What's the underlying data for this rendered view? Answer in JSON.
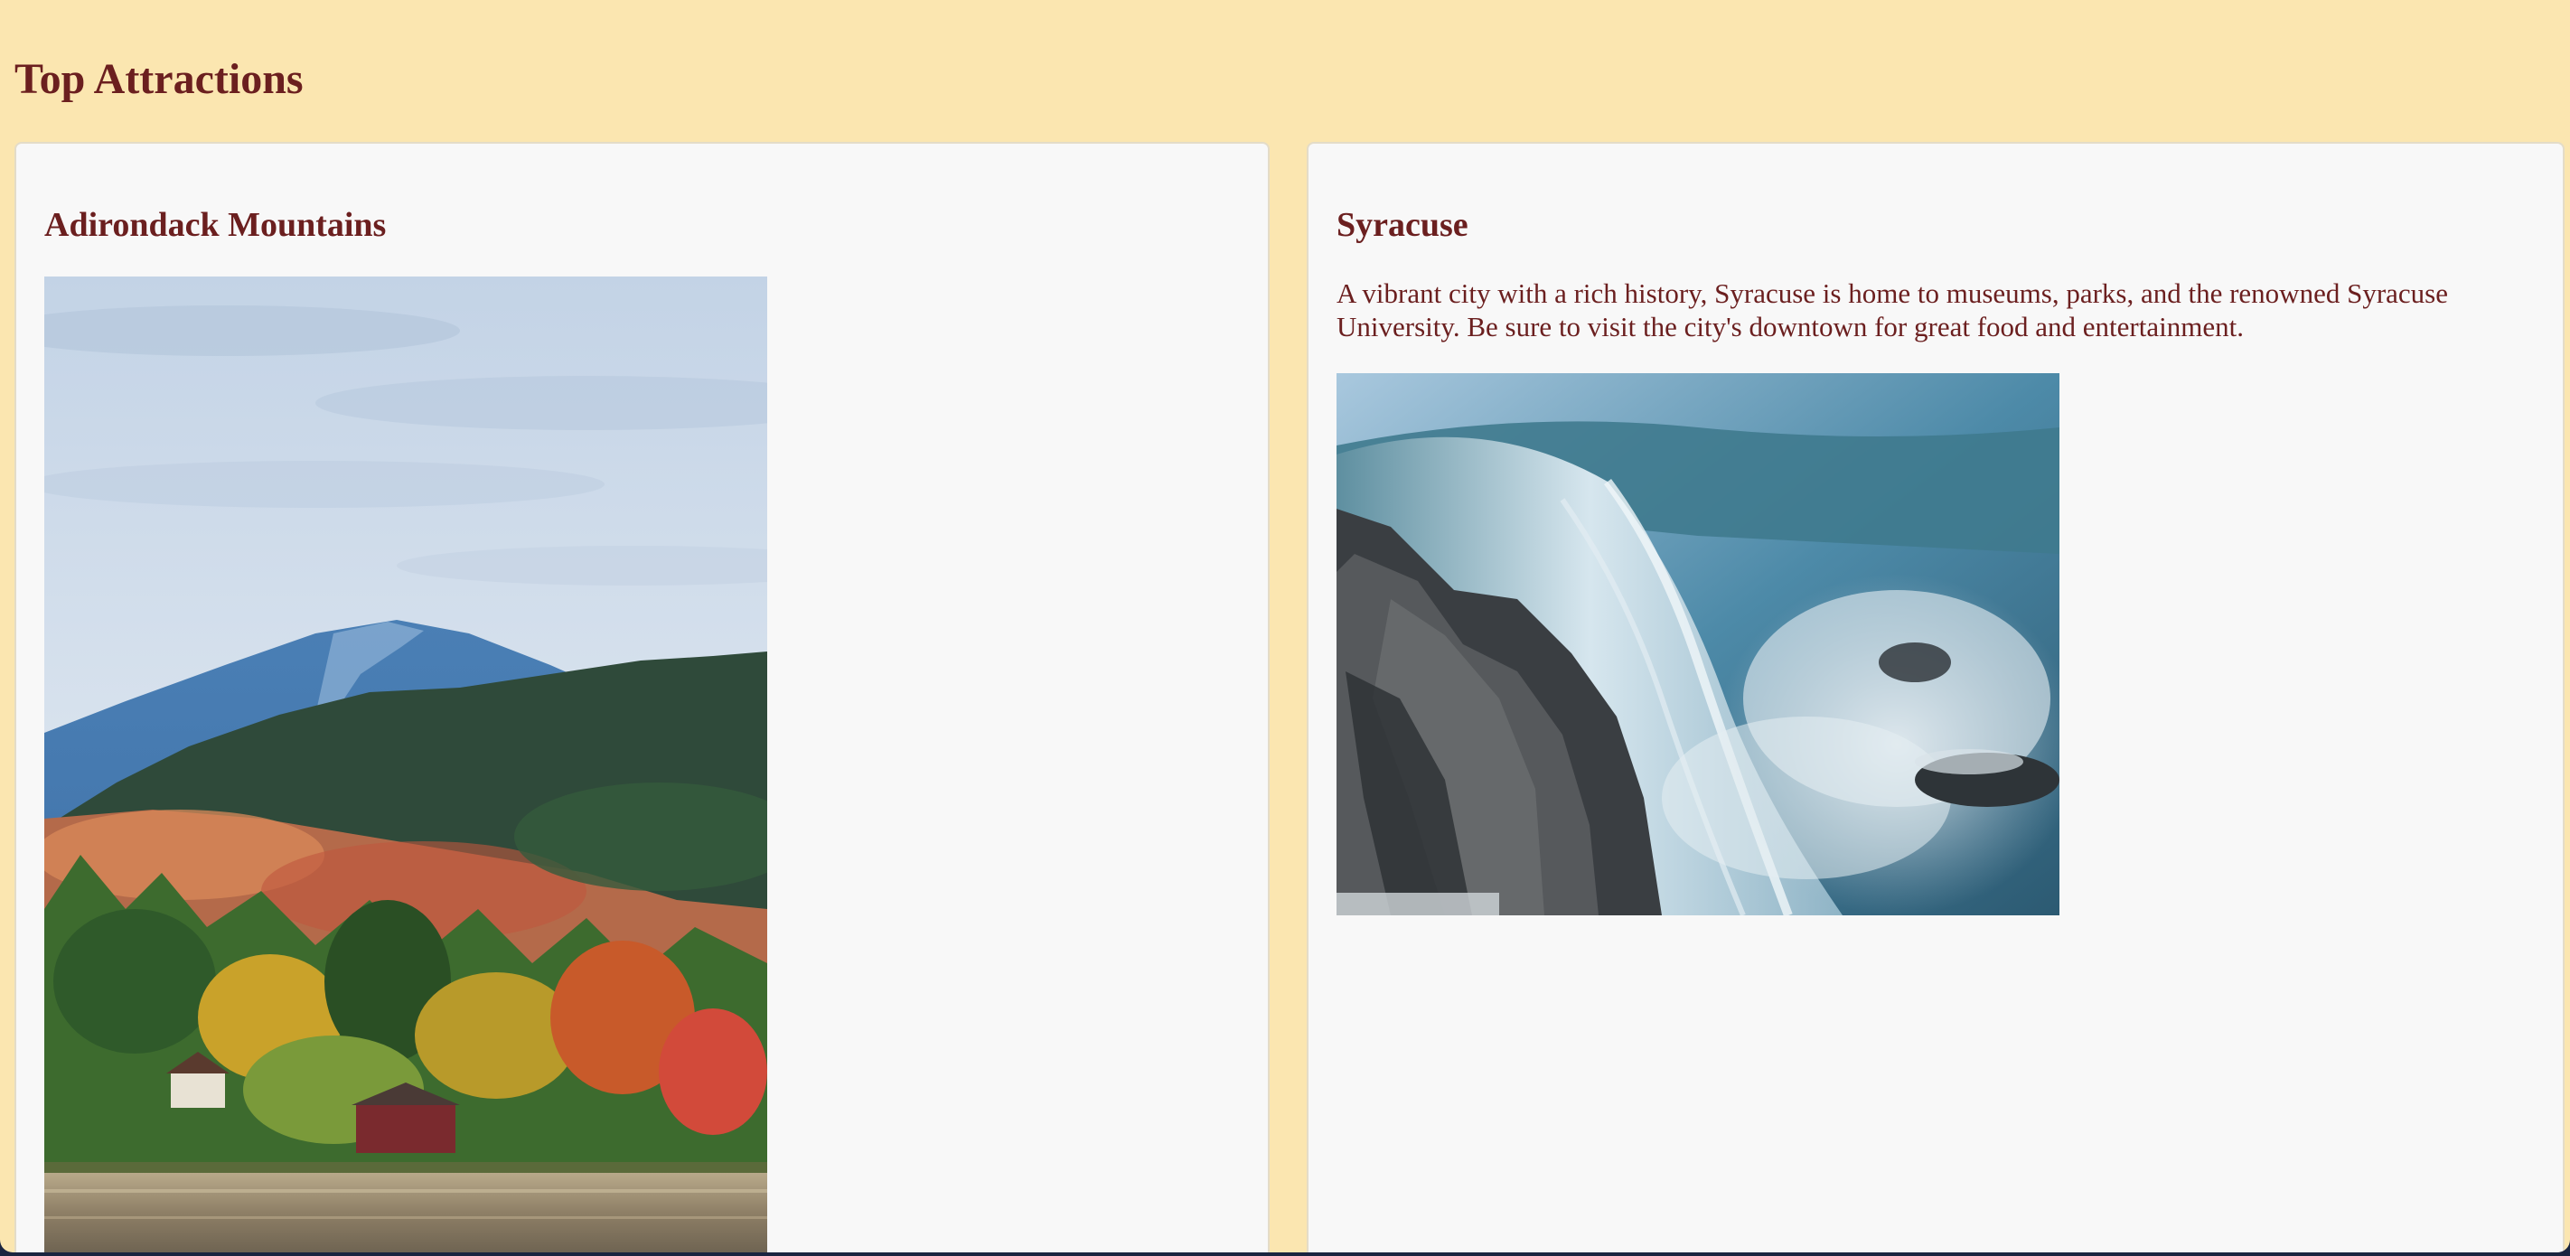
{
  "page": {
    "title": "Top Attractions"
  },
  "attractions": [
    {
      "name": "Adirondack Mountains",
      "description": "",
      "image_icon": "mountain-lake-photo"
    },
    {
      "name": "Syracuse",
      "description": "A vibrant city with a rich history, Syracuse is home to museums, parks, and the renowned Syracuse University. Be sure to visit the city's downtown for great food and entertainment.",
      "image_icon": "waterfall-photo"
    }
  ],
  "colors": {
    "page_background": "#fbe6b0",
    "card_background": "#f8f8f8",
    "text": "#6b1f1f"
  }
}
